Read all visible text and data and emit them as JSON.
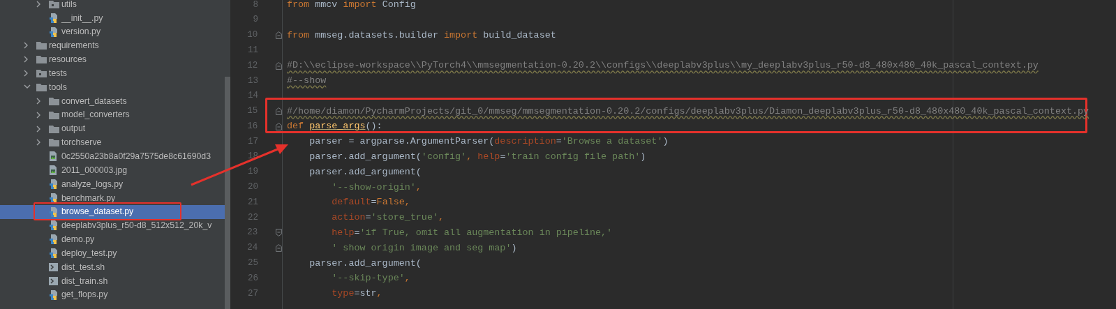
{
  "project_tree": [
    {
      "children": [
        {
          "label": "utils",
          "kind": "package",
          "expanded": false,
          "selected": false
        },
        {
          "label": "__init__.py",
          "kind": "python",
          "selected": false
        },
        {
          "label": "version.py",
          "kind": "python",
          "selected": false
        }
      ]
    },
    {
      "label": "requirements",
      "kind": "folder",
      "expanded": false,
      "selected": false
    },
    {
      "label": "resources",
      "kind": "folder",
      "expanded": false,
      "selected": false
    },
    {
      "label": "tests",
      "kind": "package",
      "expanded": false,
      "selected": false
    },
    {
      "label": "tools",
      "kind": "folder",
      "expanded": true,
      "selected": false,
      "children": [
        {
          "label": "convert_datasets",
          "kind": "folder",
          "expanded": false,
          "selected": false
        },
        {
          "label": "model_converters",
          "kind": "folder",
          "expanded": false,
          "selected": false
        },
        {
          "label": "output",
          "kind": "folder",
          "expanded": false,
          "selected": false
        },
        {
          "label": "torchserve",
          "kind": "folder",
          "expanded": false,
          "selected": false
        },
        {
          "label": "0c2550a23b8a0f29a7575de8c61690d3",
          "kind": "image",
          "selected": false
        },
        {
          "label": "2011_000003.jpg",
          "kind": "image",
          "selected": false
        },
        {
          "label": "analyze_logs.py",
          "kind": "python",
          "selected": false
        },
        {
          "label": "benchmark.py",
          "kind": "python",
          "selected": false
        },
        {
          "label": "browse_dataset.py",
          "kind": "python",
          "selected": true
        },
        {
          "label": "deeplabv3plus_r50-d8_512x512_20k_v",
          "kind": "python",
          "selected": false
        },
        {
          "label": "demo.py",
          "kind": "python",
          "selected": false
        },
        {
          "label": "deploy_test.py",
          "kind": "python",
          "selected": false
        },
        {
          "label": "dist_test.sh",
          "kind": "shell",
          "selected": false
        },
        {
          "label": "dist_train.sh",
          "kind": "shell",
          "selected": false
        },
        {
          "label": "get_flops.py",
          "kind": "python",
          "selected": false
        }
      ]
    }
  ],
  "editor": {
    "lines": [
      {
        "number": "8",
        "tokens": [
          {
            "kind": "keyword",
            "text": "from"
          },
          {
            "kind": "plain",
            "text": " mmcv "
          },
          {
            "kind": "keyword",
            "text": "import"
          },
          {
            "kind": "plain",
            "text": " Config"
          }
        ]
      },
      {
        "number": "9"
      },
      {
        "number": "10",
        "fold_start": true,
        "tokens": [
          {
            "kind": "keyword",
            "text": "from"
          },
          {
            "kind": "plain",
            "text": " mmseg.datasets.builder "
          },
          {
            "kind": "keyword",
            "text": "import"
          },
          {
            "kind": "plain",
            "text": " build_dataset"
          }
        ]
      },
      {
        "number": "11"
      },
      {
        "number": "12",
        "fold_start": true,
        "tokens": [
          {
            "kind": "comment",
            "text": "#D:\\\\eclipse-workspace\\\\PyTorch4\\\\mmsegmentation-0.20.2\\\\configs\\\\deeplabv3plus\\\\my_deeplabv3plus_r50-d8_480x480_40k_pascal_context.py"
          }
        ]
      },
      {
        "number": "13",
        "tokens": [
          {
            "kind": "comment",
            "text": "#--show"
          }
        ]
      },
      {
        "number": "14"
      },
      {
        "number": "15",
        "fold_start": true,
        "tokens": [
          {
            "kind": "comment",
            "text": "#/home/diamon/PycharmProjects/git_0/mmseg/mmsegmentation-0.20.2/configs/deeplabv3plus/Diamon_deeplabv3plus_r50-d8_480x480_40k_pascal_context.py"
          }
        ]
      },
      {
        "number": "16",
        "fold_start": true,
        "tokens": [
          {
            "kind": "keyword",
            "text": "def "
          },
          {
            "kind": "function",
            "text": "parse_args"
          },
          {
            "kind": "plain",
            "text": "():"
          }
        ]
      },
      {
        "number": "17",
        "tokens": [
          {
            "kind": "plain",
            "text": "    parser = argparse.ArgumentParser("
          },
          {
            "kind": "param",
            "text": "description"
          },
          {
            "kind": "plain",
            "text": "="
          },
          {
            "kind": "string",
            "text": "'Browse a dataset'"
          },
          {
            "kind": "plain",
            "text": ")"
          }
        ]
      },
      {
        "number": "18",
        "tokens": [
          {
            "kind": "plain",
            "text": "    parser.add_argument("
          },
          {
            "kind": "string",
            "text": "'config'"
          },
          {
            "kind": "keyword",
            "text": ","
          },
          {
            "kind": "param",
            "text": " help"
          },
          {
            "kind": "plain",
            "text": "="
          },
          {
            "kind": "string",
            "text": "'train config file path'"
          },
          {
            "kind": "plain",
            "text": ")"
          }
        ]
      },
      {
        "number": "19",
        "tokens": [
          {
            "kind": "plain",
            "text": "    parser.add_argument("
          }
        ]
      },
      {
        "number": "20",
        "tokens": [
          {
            "kind": "string",
            "text": "        '--show-origin'"
          },
          {
            "kind": "keyword",
            "text": ","
          }
        ]
      },
      {
        "number": "21",
        "tokens": [
          {
            "kind": "param",
            "text": "        default"
          },
          {
            "kind": "plain",
            "text": "="
          },
          {
            "kind": "keyword",
            "text": "False,"
          }
        ]
      },
      {
        "number": "22",
        "tokens": [
          {
            "kind": "param",
            "text": "        action"
          },
          {
            "kind": "plain",
            "text": "="
          },
          {
            "kind": "string",
            "text": "'store_true'"
          },
          {
            "kind": "keyword",
            "text": ","
          }
        ]
      },
      {
        "number": "23",
        "fold_end": true,
        "tokens": [
          {
            "kind": "param",
            "text": "        help"
          },
          {
            "kind": "plain",
            "text": "="
          },
          {
            "kind": "string",
            "text": "'if True, omit all augmentation in pipeline,'"
          }
        ]
      },
      {
        "number": "24",
        "fold_start": true,
        "tokens": [
          {
            "kind": "string",
            "text": "        ' show origin image and seg map'"
          },
          {
            "kind": "plain",
            "text": ")"
          }
        ]
      },
      {
        "number": "25",
        "tokens": [
          {
            "kind": "plain",
            "text": "    parser.add_argument("
          }
        ]
      },
      {
        "number": "26",
        "tokens": [
          {
            "kind": "string",
            "text": "        '--skip-type'"
          },
          {
            "kind": "keyword",
            "text": ","
          }
        ]
      },
      {
        "number": "27",
        "tokens": [
          {
            "kind": "param",
            "text": "        type"
          },
          {
            "kind": "plain",
            "text": "=str"
          },
          {
            "kind": "keyword",
            "text": ","
          }
        ]
      }
    ]
  }
}
